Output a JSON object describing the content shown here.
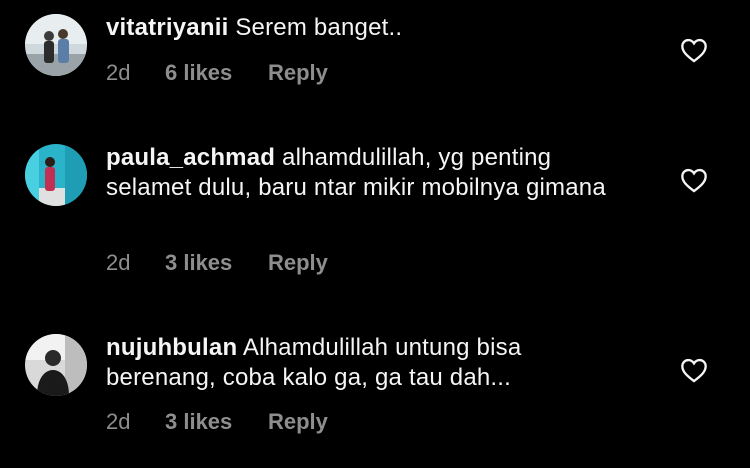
{
  "comments": [
    {
      "username": "vitatriyanii",
      "text": "Serem banget..",
      "time": "2d",
      "likes": "6 likes",
      "reply": "Reply",
      "avatar_icon": "profile-photo"
    },
    {
      "username": "paula_achmad",
      "text": "alhamdulillah, yg penting selamet dulu, baru ntar mikir mobilnya gimana",
      "time": "2d",
      "likes": "3 likes",
      "reply": "Reply",
      "avatar_icon": "profile-photo"
    },
    {
      "username": "nujuhbulan",
      "text": "Alhamdulillah untung bisa berenang, coba kalo ga, ga tau dah...",
      "time": "2d",
      "likes": "3 likes",
      "reply": "Reply",
      "avatar_icon": "profile-photo"
    }
  ],
  "like_icon": "heart-outline-icon",
  "colors": {
    "background": "#000000",
    "primary_text": "#f5f5f5",
    "secondary_text": "#8e8e8e"
  }
}
